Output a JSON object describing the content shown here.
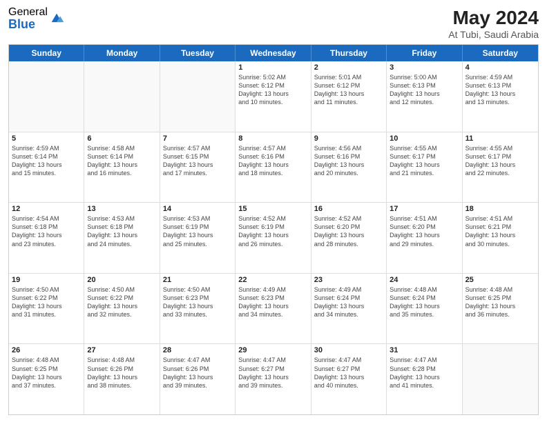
{
  "logo": {
    "general": "General",
    "blue": "Blue"
  },
  "title": {
    "month": "May 2024",
    "location": "At Tubi, Saudi Arabia"
  },
  "header_days": [
    "Sunday",
    "Monday",
    "Tuesday",
    "Wednesday",
    "Thursday",
    "Friday",
    "Saturday"
  ],
  "weeks": [
    [
      {
        "day": "",
        "info": ""
      },
      {
        "day": "",
        "info": ""
      },
      {
        "day": "",
        "info": ""
      },
      {
        "day": "1",
        "info": "Sunrise: 5:02 AM\nSunset: 6:12 PM\nDaylight: 13 hours\nand 10 minutes."
      },
      {
        "day": "2",
        "info": "Sunrise: 5:01 AM\nSunset: 6:12 PM\nDaylight: 13 hours\nand 11 minutes."
      },
      {
        "day": "3",
        "info": "Sunrise: 5:00 AM\nSunset: 6:13 PM\nDaylight: 13 hours\nand 12 minutes."
      },
      {
        "day": "4",
        "info": "Sunrise: 4:59 AM\nSunset: 6:13 PM\nDaylight: 13 hours\nand 13 minutes."
      }
    ],
    [
      {
        "day": "5",
        "info": "Sunrise: 4:59 AM\nSunset: 6:14 PM\nDaylight: 13 hours\nand 15 minutes."
      },
      {
        "day": "6",
        "info": "Sunrise: 4:58 AM\nSunset: 6:14 PM\nDaylight: 13 hours\nand 16 minutes."
      },
      {
        "day": "7",
        "info": "Sunrise: 4:57 AM\nSunset: 6:15 PM\nDaylight: 13 hours\nand 17 minutes."
      },
      {
        "day": "8",
        "info": "Sunrise: 4:57 AM\nSunset: 6:16 PM\nDaylight: 13 hours\nand 18 minutes."
      },
      {
        "day": "9",
        "info": "Sunrise: 4:56 AM\nSunset: 6:16 PM\nDaylight: 13 hours\nand 20 minutes."
      },
      {
        "day": "10",
        "info": "Sunrise: 4:55 AM\nSunset: 6:17 PM\nDaylight: 13 hours\nand 21 minutes."
      },
      {
        "day": "11",
        "info": "Sunrise: 4:55 AM\nSunset: 6:17 PM\nDaylight: 13 hours\nand 22 minutes."
      }
    ],
    [
      {
        "day": "12",
        "info": "Sunrise: 4:54 AM\nSunset: 6:18 PM\nDaylight: 13 hours\nand 23 minutes."
      },
      {
        "day": "13",
        "info": "Sunrise: 4:53 AM\nSunset: 6:18 PM\nDaylight: 13 hours\nand 24 minutes."
      },
      {
        "day": "14",
        "info": "Sunrise: 4:53 AM\nSunset: 6:19 PM\nDaylight: 13 hours\nand 25 minutes."
      },
      {
        "day": "15",
        "info": "Sunrise: 4:52 AM\nSunset: 6:19 PM\nDaylight: 13 hours\nand 26 minutes."
      },
      {
        "day": "16",
        "info": "Sunrise: 4:52 AM\nSunset: 6:20 PM\nDaylight: 13 hours\nand 28 minutes."
      },
      {
        "day": "17",
        "info": "Sunrise: 4:51 AM\nSunset: 6:20 PM\nDaylight: 13 hours\nand 29 minutes."
      },
      {
        "day": "18",
        "info": "Sunrise: 4:51 AM\nSunset: 6:21 PM\nDaylight: 13 hours\nand 30 minutes."
      }
    ],
    [
      {
        "day": "19",
        "info": "Sunrise: 4:50 AM\nSunset: 6:22 PM\nDaylight: 13 hours\nand 31 minutes."
      },
      {
        "day": "20",
        "info": "Sunrise: 4:50 AM\nSunset: 6:22 PM\nDaylight: 13 hours\nand 32 minutes."
      },
      {
        "day": "21",
        "info": "Sunrise: 4:50 AM\nSunset: 6:23 PM\nDaylight: 13 hours\nand 33 minutes."
      },
      {
        "day": "22",
        "info": "Sunrise: 4:49 AM\nSunset: 6:23 PM\nDaylight: 13 hours\nand 34 minutes."
      },
      {
        "day": "23",
        "info": "Sunrise: 4:49 AM\nSunset: 6:24 PM\nDaylight: 13 hours\nand 34 minutes."
      },
      {
        "day": "24",
        "info": "Sunrise: 4:48 AM\nSunset: 6:24 PM\nDaylight: 13 hours\nand 35 minutes."
      },
      {
        "day": "25",
        "info": "Sunrise: 4:48 AM\nSunset: 6:25 PM\nDaylight: 13 hours\nand 36 minutes."
      }
    ],
    [
      {
        "day": "26",
        "info": "Sunrise: 4:48 AM\nSunset: 6:25 PM\nDaylight: 13 hours\nand 37 minutes."
      },
      {
        "day": "27",
        "info": "Sunrise: 4:48 AM\nSunset: 6:26 PM\nDaylight: 13 hours\nand 38 minutes."
      },
      {
        "day": "28",
        "info": "Sunrise: 4:47 AM\nSunset: 6:26 PM\nDaylight: 13 hours\nand 39 minutes."
      },
      {
        "day": "29",
        "info": "Sunrise: 4:47 AM\nSunset: 6:27 PM\nDaylight: 13 hours\nand 39 minutes."
      },
      {
        "day": "30",
        "info": "Sunrise: 4:47 AM\nSunset: 6:27 PM\nDaylight: 13 hours\nand 40 minutes."
      },
      {
        "day": "31",
        "info": "Sunrise: 4:47 AM\nSunset: 6:28 PM\nDaylight: 13 hours\nand 41 minutes."
      },
      {
        "day": "",
        "info": ""
      }
    ]
  ]
}
